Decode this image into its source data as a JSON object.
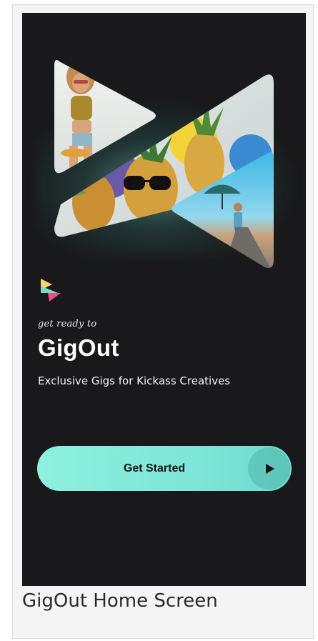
{
  "app": {
    "tagline": "get ready to",
    "brand": "GigOut",
    "subtitle": "Exclusive Gigs for Kickass Creatives"
  },
  "cta": {
    "label": "Get Started",
    "icon": "play-icon"
  },
  "collage": {
    "panels": [
      "woman-with-skateboard-photo",
      "pineapples-with-sunglasses-photo",
      "man-with-umbrella-photo"
    ]
  },
  "logo": {
    "icon": "gigout-logo-icon",
    "colors": [
      "#f9d66b",
      "#7ee3d6",
      "#e9508b"
    ]
  },
  "caption": "GigOut Home Screen",
  "theme": {
    "background": "#19191b",
    "accent": "#7fe6d8",
    "text": "#ffffff"
  }
}
